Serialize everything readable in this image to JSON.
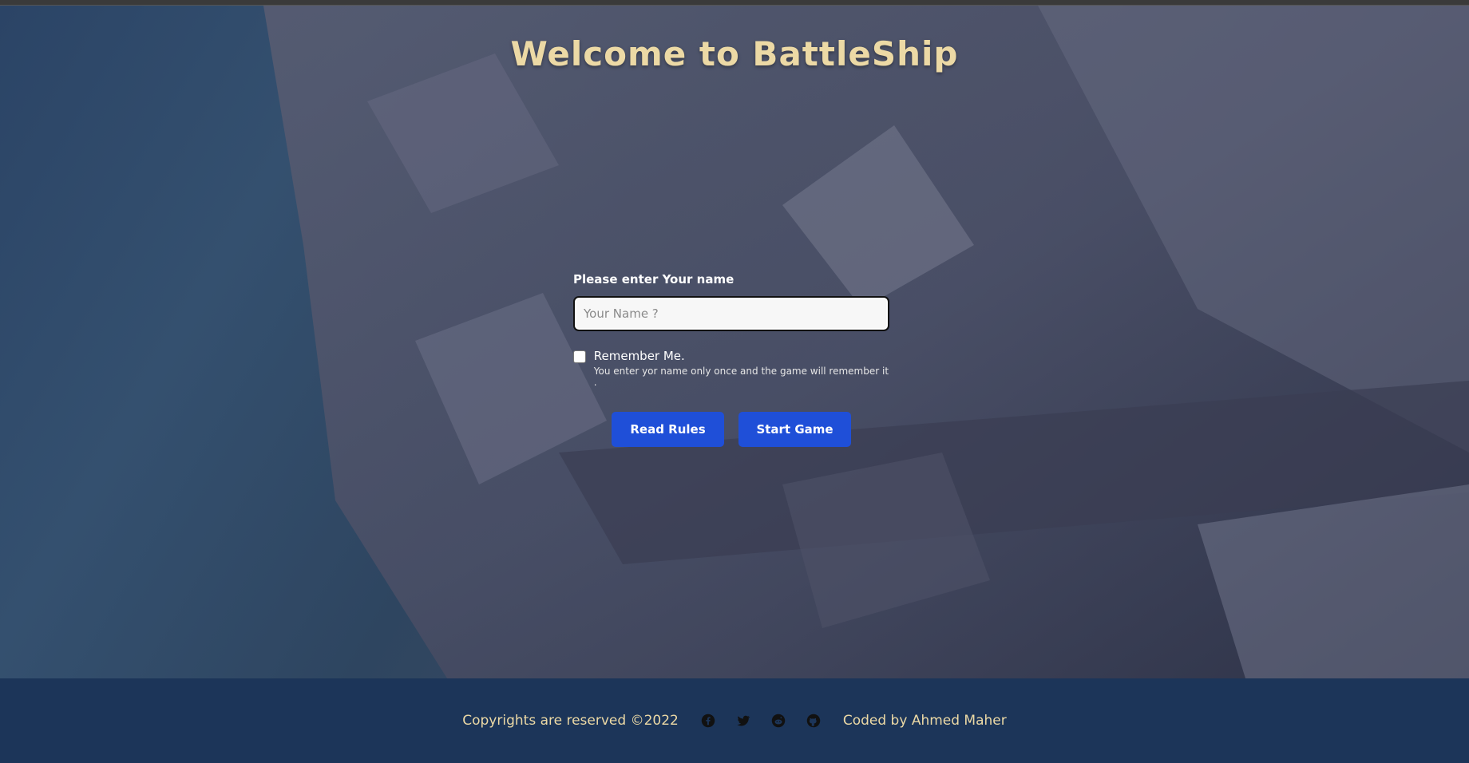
{
  "header": {
    "title": "Welcome to BattleShip"
  },
  "form": {
    "name_label": "Please enter Your name",
    "name_placeholder": "Your Name ?",
    "name_value": "",
    "remember_label": "Remember Me.",
    "remember_help": "You enter yor name only once and the game will remember it .",
    "remember_checked": false
  },
  "buttons": {
    "read_rules": "Read Rules",
    "start_game": "Start Game"
  },
  "footer": {
    "copyright": "Copyrights are reserved ©2022",
    "credit": "Coded by Ahmed Maher",
    "icons": [
      "facebook-icon",
      "twitter-icon",
      "reddit-icon",
      "github-icon"
    ]
  },
  "colors": {
    "title": "#ecd9a5",
    "button": "#1f4fd8",
    "footer_bg": "#1c3559",
    "footer_text": "#ecd9a5"
  }
}
